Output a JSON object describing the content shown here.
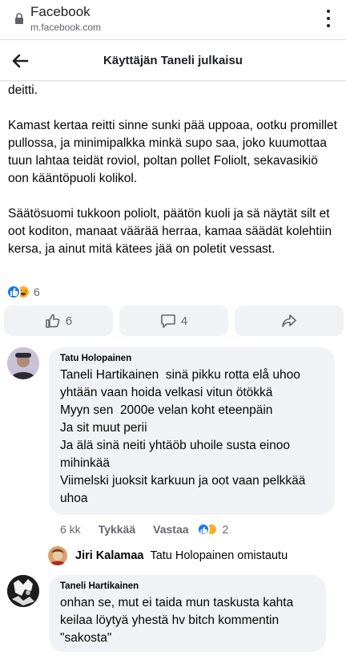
{
  "browser": {
    "title": "Facebook",
    "url": "m.facebook.com"
  },
  "header": {
    "title": "Käyttäjän Taneli julkaisu"
  },
  "post": {
    "paragraphs": [
      "deitti.",
      "Kamast kertaa reitti sinne sunki pää uppoaa, ootku promillet pullossa, ja minimipalkka minkä supo saa, joko kuumottaa tuun lahtaa teidät roviol, poltan pollet Foliolt, sekavasikiö oon kääntöpuoli kolikol.",
      "Säätösuomi tukkoon poliolt, päätön kuoli ja sä näytät silt et oot koditon, manaat väärää herraa, kamaa säädät kolehtiin kersa, ja ainut mitä kätees jää on poletit vessast."
    ],
    "reaction_count": "6",
    "actions": {
      "like_count": "6",
      "comment_count": "4"
    }
  },
  "comments": [
    {
      "author": "Tatu Holopainen",
      "lines": [
        "Taneli Hartikainen  sinä pikku rotta elå uhoo yhtään vaan hoida velkasi vitun ötökkä",
        "Myyn sen  2000e velan koht eteenpäin",
        "Ja sit muut perii",
        "Ja älä sinä neiti yhtäöb uhoile susta einoo mihinkää",
        "Viimelski juoksit karkuun ja oot vaan pelkkää uhoa"
      ],
      "time": "6 kk",
      "like_label": "Tykkää",
      "reply_label": "Vastaa",
      "reaction_count": "2",
      "reply_preview": {
        "author": "Jiri Kalamaa",
        "text": "Tatu Holopainen omistautu"
      }
    },
    {
      "author": "Taneli Hartikainen",
      "lines": [
        "onhan se, mut ei taida mun taskusta kahta keilaa löytyä yhestä hv bitch kommentin \"sakosta\""
      ]
    }
  ]
}
